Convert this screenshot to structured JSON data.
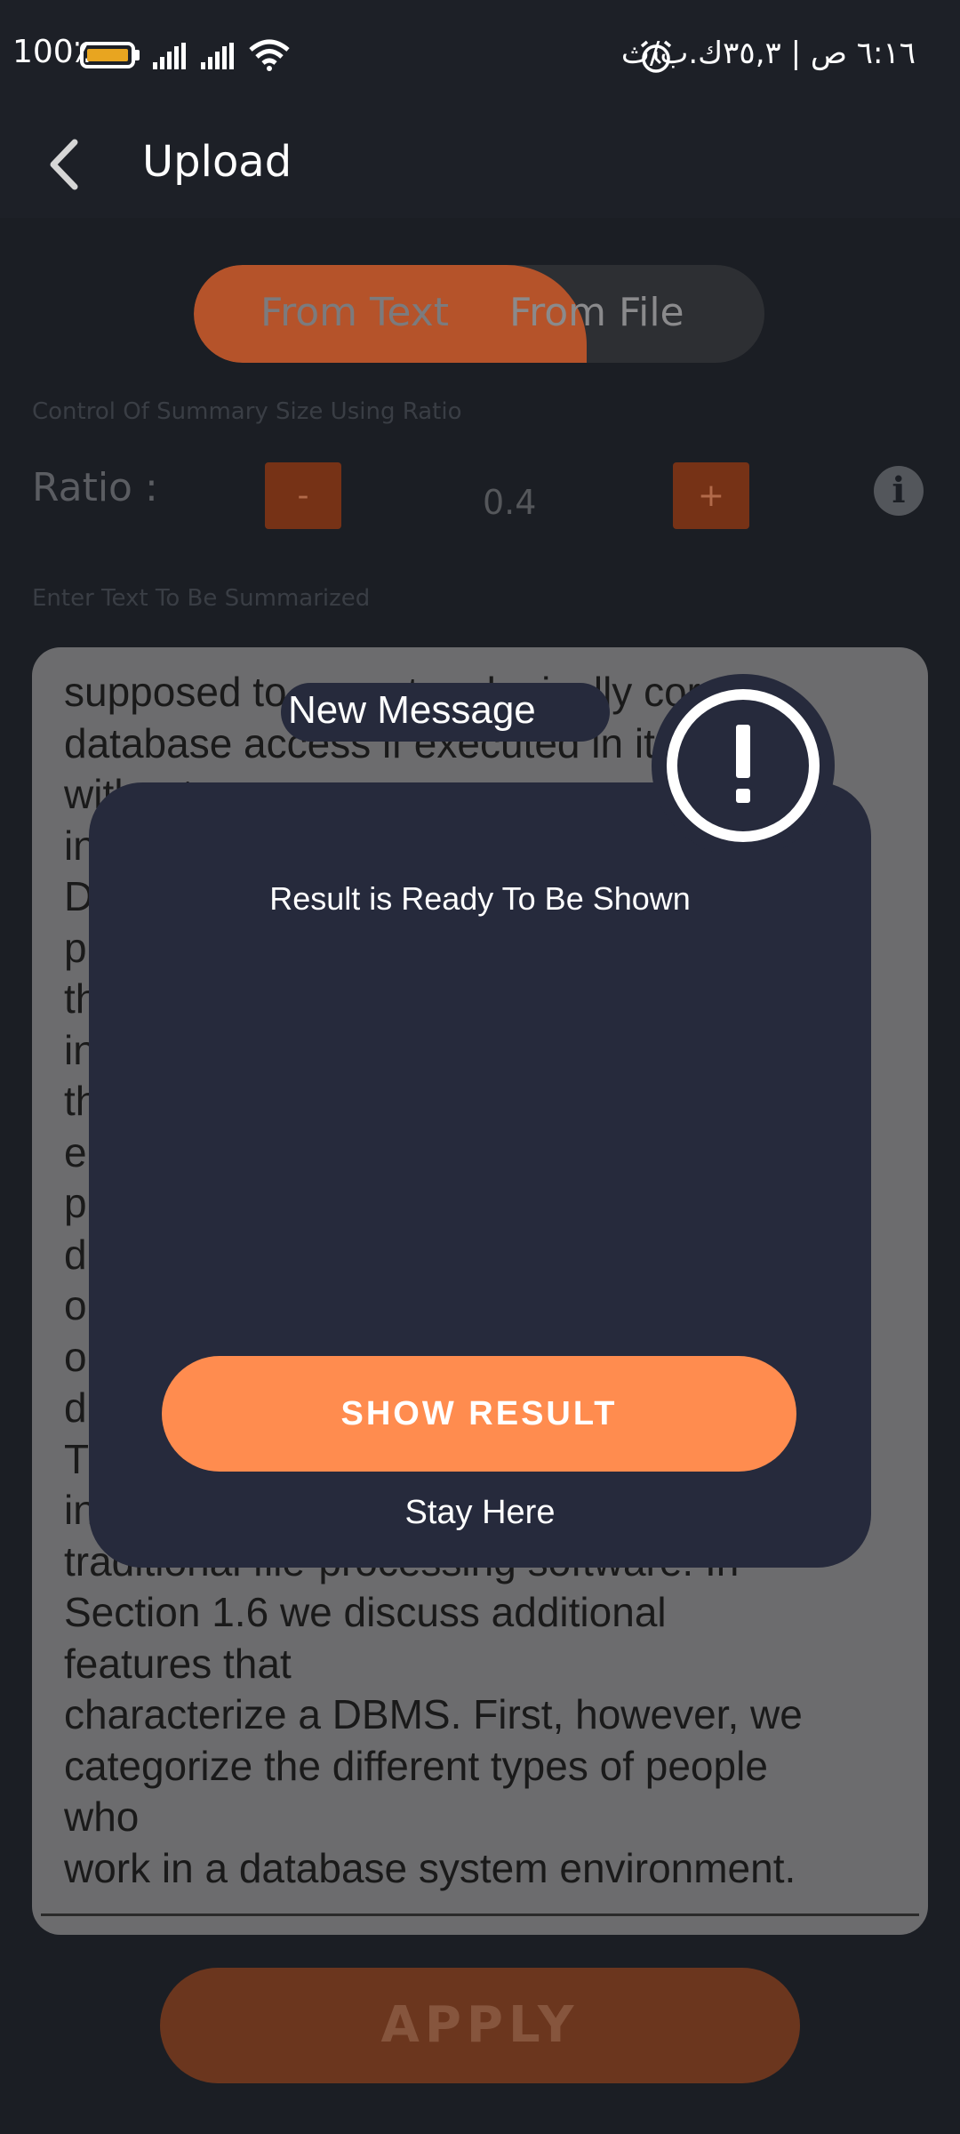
{
  "status_bar": {
    "battery_text": "100٪",
    "battery_level": 1.0,
    "right_text": "٦:١٦ ص | ٣٥,٣ك.ب/ث"
  },
  "app_bar": {
    "title": "Upload"
  },
  "tabs": {
    "from_text": "From Text",
    "from_file": "From File",
    "active": "From Text"
  },
  "ratio": {
    "hint": "Control Of Summary Size Using Ratio",
    "label": "Ratio :",
    "minus": "-",
    "value": "0.4",
    "plus": "+"
  },
  "input": {
    "hint": "Enter Text To Be Summarized",
    "lines": [
      "supposed to execute a logically correct",
      "database access if executed in its entirety",
      "without",
      "in",
      "D",
      "p",
      "th",
      "in",
      "th",
      "e",
      "p",
      "d",
      "o",
      "o",
      "d",
      "T",
      "in",
      "traditional file-processing software. In",
      "Section 1.6 we discuss additional",
      "features that",
      "characterize a DBMS. First, however, we",
      "categorize the different types of people",
      "who",
      "work in a database system environment."
    ]
  },
  "apply_label": "APPLY",
  "dialog": {
    "title": "New Message",
    "message": "Result is Ready To Be Shown",
    "primary_button": "SHOW RESULT",
    "secondary_button": "Stay Here",
    "icon": "alert-exclamation-icon",
    "accent_color": "#ff8c4f"
  },
  "colors": {
    "accent": "#ff8c4f",
    "background": "#1b1e24",
    "dialog": "#262a3c"
  }
}
